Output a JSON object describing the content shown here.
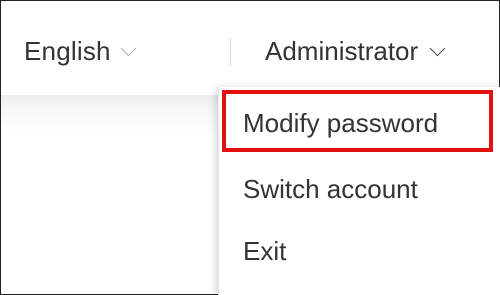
{
  "header": {
    "language": {
      "label": "English",
      "icon": "chevron-down-icon"
    },
    "user": {
      "label": "Administrator",
      "icon": "chevron-down-icon"
    }
  },
  "dropdown": {
    "items": [
      {
        "label": "Modify password",
        "highlighted": true
      },
      {
        "label": "Switch account"
      },
      {
        "label": "Exit"
      }
    ],
    "highlight_color": "#e31010"
  }
}
